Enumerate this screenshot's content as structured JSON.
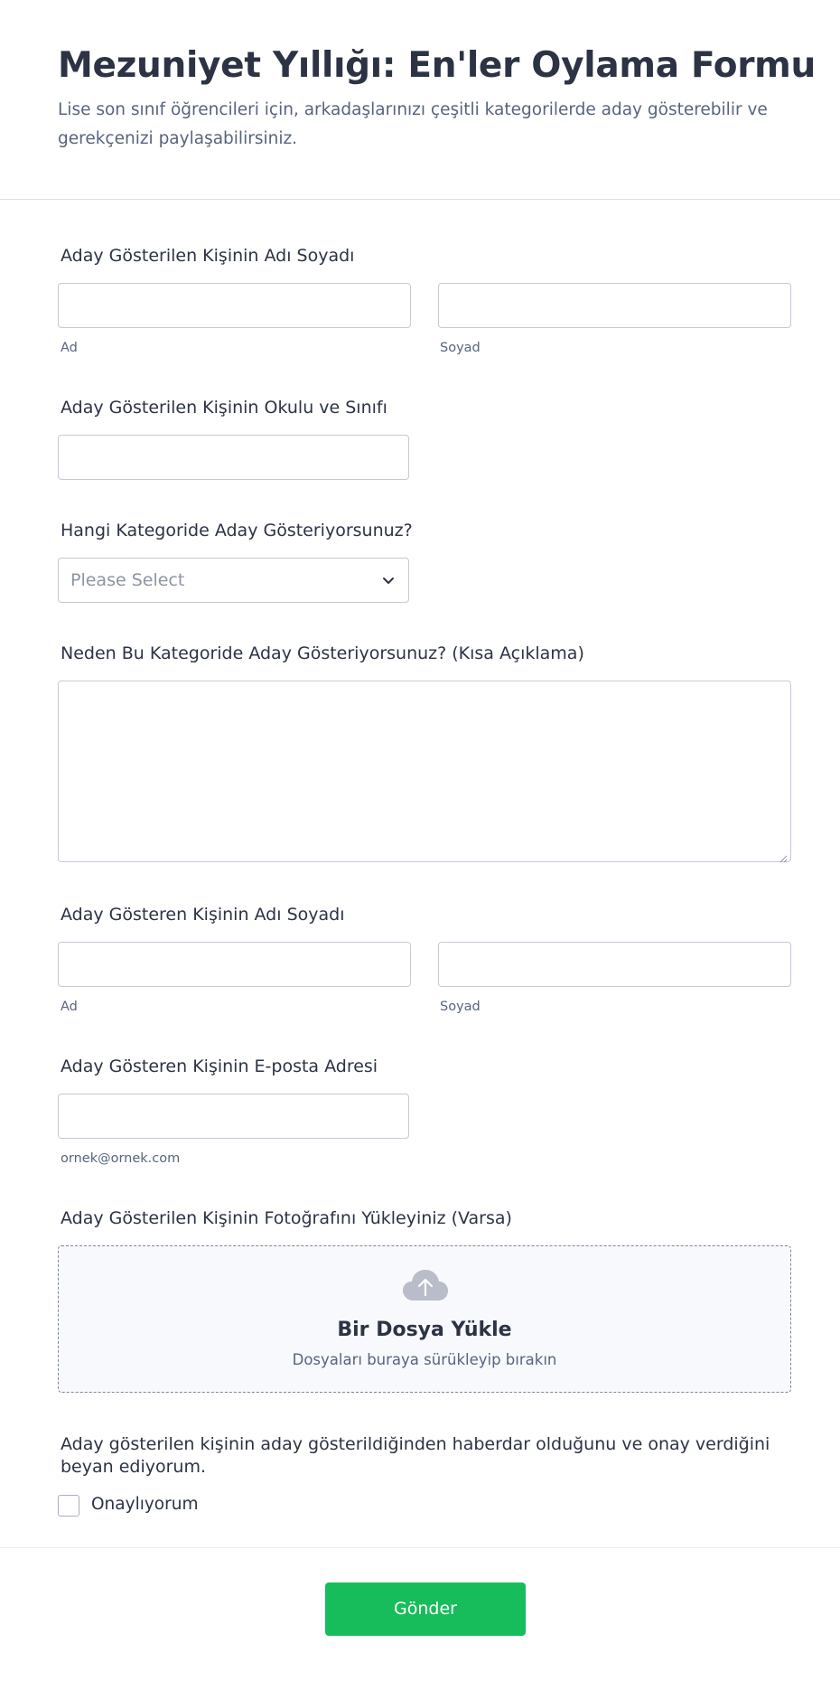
{
  "form": {
    "title": "Mezuniyet Yıllığı: En'ler Oylama Formu",
    "description": "Lise son sınıf öğrencileri için, arkadaşlarınızı çeşitli kategorilerde aday gösterebilir ve gerekçenizi paylaşabilirsiniz."
  },
  "fields": {
    "nominee_name": {
      "label": "Aday Gösterilen Kişinin Adı Soyadı",
      "first_sublabel": "Ad",
      "last_sublabel": "Soyad",
      "first_value": "",
      "last_value": ""
    },
    "nominee_school": {
      "label": "Aday Gösterilen Kişinin Okulu ve Sınıfı",
      "value": ""
    },
    "category": {
      "label": "Hangi Kategoride Aday Gösteriyorsunuz?",
      "placeholder": "Please Select"
    },
    "reason": {
      "label": "Neden Bu Kategoride Aday Gösteriyorsunuz? (Kısa Açıklama)",
      "value": ""
    },
    "nominator_name": {
      "label": "Aday Gösteren Kişinin Adı Soyadı",
      "first_sublabel": "Ad",
      "last_sublabel": "Soyad",
      "first_value": "",
      "last_value": ""
    },
    "nominator_email": {
      "label": "Aday Gösteren Kişinin E-posta Adresi",
      "sublabel": "ornek@ornek.com",
      "value": ""
    },
    "photo_upload": {
      "label": "Aday Gösterilen Kişinin Fotoğrafını Yükleyiniz (Varsa)",
      "button_title": "Bir Dosya Yükle",
      "hint": "Dosyaları buraya sürükleyip bırakın",
      "icon": "cloud-upload-icon"
    },
    "consent": {
      "statement": "Aday gösterilen kişinin aday gösterildiğinden haberdar olduğunu ve onay verdiğini beyan ediyorum.",
      "checkbox_label": "Onaylıyorum",
      "checked": false
    }
  },
  "submit": {
    "label": "Gönder",
    "color": "#18bd5b"
  },
  "colors": {
    "text": "#2c3345",
    "muted": "#57647e",
    "border": "#c3cad8"
  }
}
